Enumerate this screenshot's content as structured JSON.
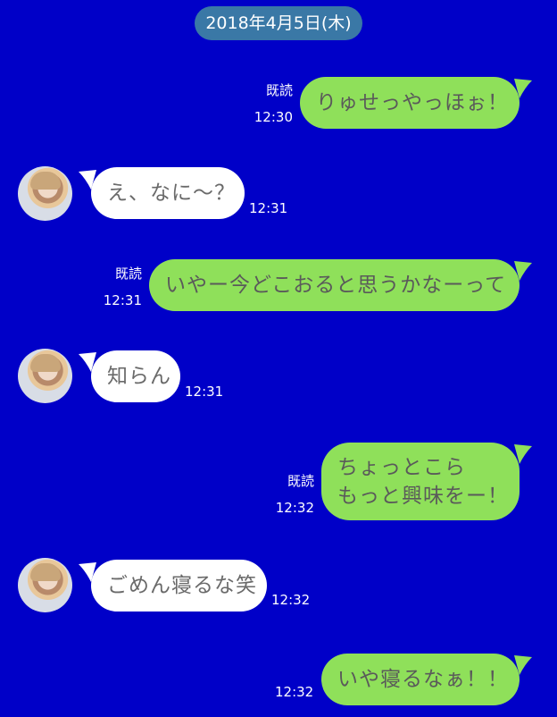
{
  "date": "2018年4月5日(木)",
  "colors": {
    "background": "#0000c8",
    "sent_bubble": "#8fe05a",
    "recv_bubble": "#ffffff",
    "date_pill": "#3a78a6"
  },
  "messages": [
    {
      "side": "sent",
      "read": "既読",
      "time": "12:30",
      "text": "りゅせっやっほぉ！"
    },
    {
      "side": "recv",
      "time": "12:31",
      "text": "え、なに〜？"
    },
    {
      "side": "sent",
      "read": "既読",
      "time": "12:31",
      "text": "いやー今どこおると思うかなーって"
    },
    {
      "side": "recv",
      "time": "12:31",
      "text": "知らん"
    },
    {
      "side": "sent",
      "read": "既読",
      "time": "12:32",
      "lines": [
        "ちょっとこら",
        "もっと興味をー！"
      ]
    },
    {
      "side": "recv",
      "time": "12:32",
      "text": "ごめん寝るな笑"
    },
    {
      "side": "sent",
      "time": "12:32",
      "text": "いや寝るなぁ！！"
    }
  ]
}
